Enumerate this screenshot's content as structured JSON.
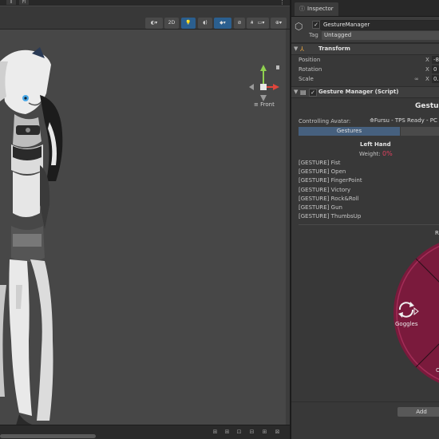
{
  "scene": {
    "top_buttons": [
      "II",
      "FI"
    ],
    "toolbar": {
      "mode_2d": "2D",
      "orientation_label": "Front"
    }
  },
  "inspector": {
    "tab_label": "Inspector",
    "object_name": "GestureManager",
    "tag_label": "Tag",
    "tag_value": "Untagged",
    "transform": {
      "title": "Transform",
      "rows": [
        {
          "label": "Position",
          "axis": "X",
          "value": "-8"
        },
        {
          "label": "Rotation",
          "axis": "X",
          "value": "0"
        },
        {
          "label": "Scale",
          "axis": "X",
          "value": "0.2"
        }
      ]
    },
    "script": {
      "title": "Gesture Manager (Script)",
      "heading": "Gesture",
      "controlling_label": "Controlling Avatar:",
      "controlling_value": "Fursu - TPS Ready - PC",
      "tabs": [
        "Gestures",
        ""
      ],
      "hand_title": "Left Hand",
      "weight_label": "Weight:",
      "weight_value": "0%",
      "gestures": [
        "[GESTURE] Fist",
        "[GESTURE] Open",
        "[GESTURE] FingerPoint",
        "[GESTURE] Victory",
        "[GESTURE] Rock&Roll",
        "[GESTURE] Gun",
        "[GESTURE] ThumbsUp"
      ],
      "radial": {
        "top_label": "R",
        "item_label": "Goggles",
        "bottom_label": "C",
        "accent_color": "#7a1a3c"
      },
      "add_button": "Add"
    }
  },
  "colors": {
    "scene_bg": "#474747",
    "panel_bg": "#383838",
    "weight_color": "#e0405f",
    "radial_color": "#7a1a3c"
  }
}
